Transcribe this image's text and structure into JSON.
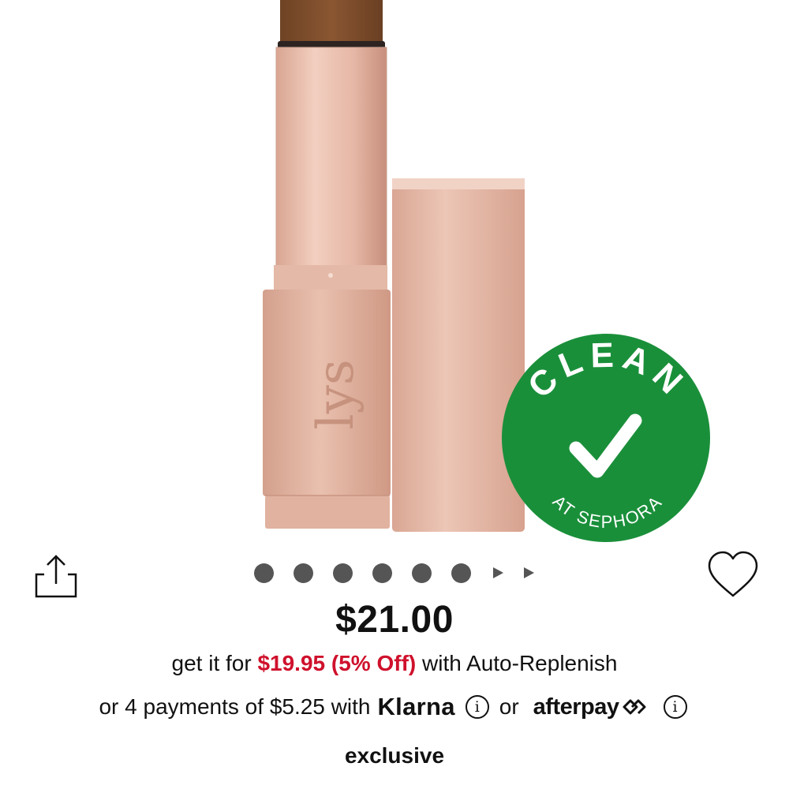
{
  "product_image": {
    "monogram": "lys",
    "badge": {
      "top_text": "CLEAN",
      "bottom_text": "AT SEPHORA",
      "color": "#1a8f3a"
    }
  },
  "actions": {
    "share_icon": "share-icon",
    "wishlist_icon": "heart-icon"
  },
  "carousel": {
    "dot_count": 6,
    "arrow_count": 2,
    "color": "#555555"
  },
  "price": {
    "current": "$21.00"
  },
  "auto_replenish": {
    "prefix": "get it for",
    "sale_price": "$19.95 (5% Off)",
    "suffix": "with Auto-Replenish",
    "sale_color": "#cf112c"
  },
  "payments": {
    "prefix": "or 4 payments of $5.25 with",
    "klarna_label": "Klarna",
    "info_glyph": "i",
    "or_text": "or",
    "afterpay_label": "afterpay"
  },
  "tag": {
    "label": "exclusive"
  }
}
